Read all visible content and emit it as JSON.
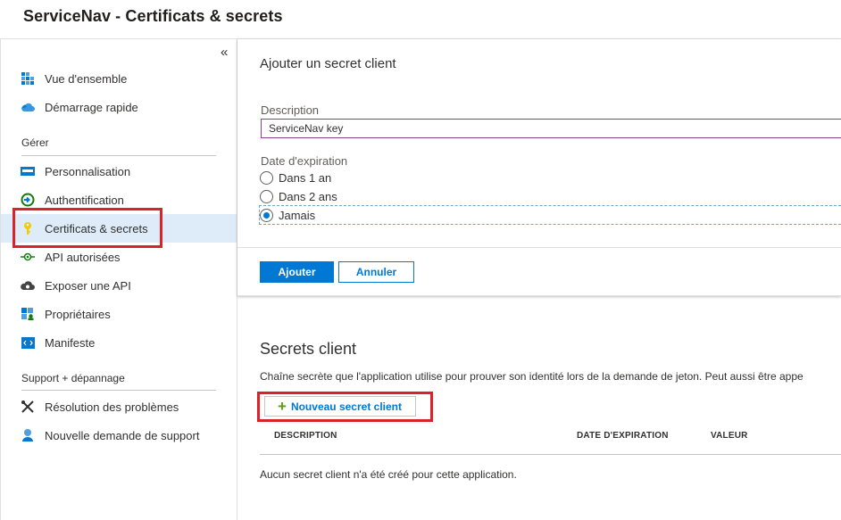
{
  "header": {
    "title": "ServiceNav - Certificats & secrets"
  },
  "sidebar": {
    "collapse_glyph": "«",
    "items": [
      {
        "label": "Vue d'ensemble",
        "icon": "grid-icon"
      },
      {
        "label": "Démarrage rapide",
        "icon": "cloud-icon"
      },
      {
        "label": "Personnalisation",
        "icon": "branding-icon"
      },
      {
        "label": "Authentification",
        "icon": "auth-icon"
      },
      {
        "label": "Certificats & secrets",
        "icon": "key-icon"
      },
      {
        "label": "API autorisées",
        "icon": "api-permissions-icon"
      },
      {
        "label": "Exposer une API",
        "icon": "cloud-gear-icon"
      },
      {
        "label": "Propriétaires",
        "icon": "owners-icon"
      },
      {
        "label": "Manifeste",
        "icon": "manifest-icon"
      },
      {
        "label": "Résolution des problèmes",
        "icon": "wrench-icon"
      },
      {
        "label": "Nouvelle demande de support",
        "icon": "support-icon"
      }
    ],
    "sections": {
      "manage": "Gérer",
      "support": "Support + dépannage"
    }
  },
  "add_secret_panel": {
    "title": "Ajouter un secret client",
    "description_label": "Description",
    "description_value": "ServiceNav key",
    "expiration_label": "Date d'expiration",
    "options": [
      "Dans 1 an",
      "Dans 2 ans",
      "Jamais"
    ],
    "selected_option": "Jamais",
    "add_button": "Ajouter",
    "cancel_button": "Annuler"
  },
  "client_secrets": {
    "title": "Secrets client",
    "description": "Chaîne secrète que l'application utilise pour prouver son identité lors de la demande de jeton. Peut aussi être appe",
    "new_button": "Nouveau secret client",
    "columns": [
      "DESCRIPTION",
      "DATE D'EXPIRATION",
      "VALEUR"
    ],
    "empty_message": "Aucun secret client n'a été créé pour cette application."
  },
  "colors": {
    "accent": "#0078d4",
    "highlight": "#d9222a",
    "active_nav": "#deecf9"
  }
}
